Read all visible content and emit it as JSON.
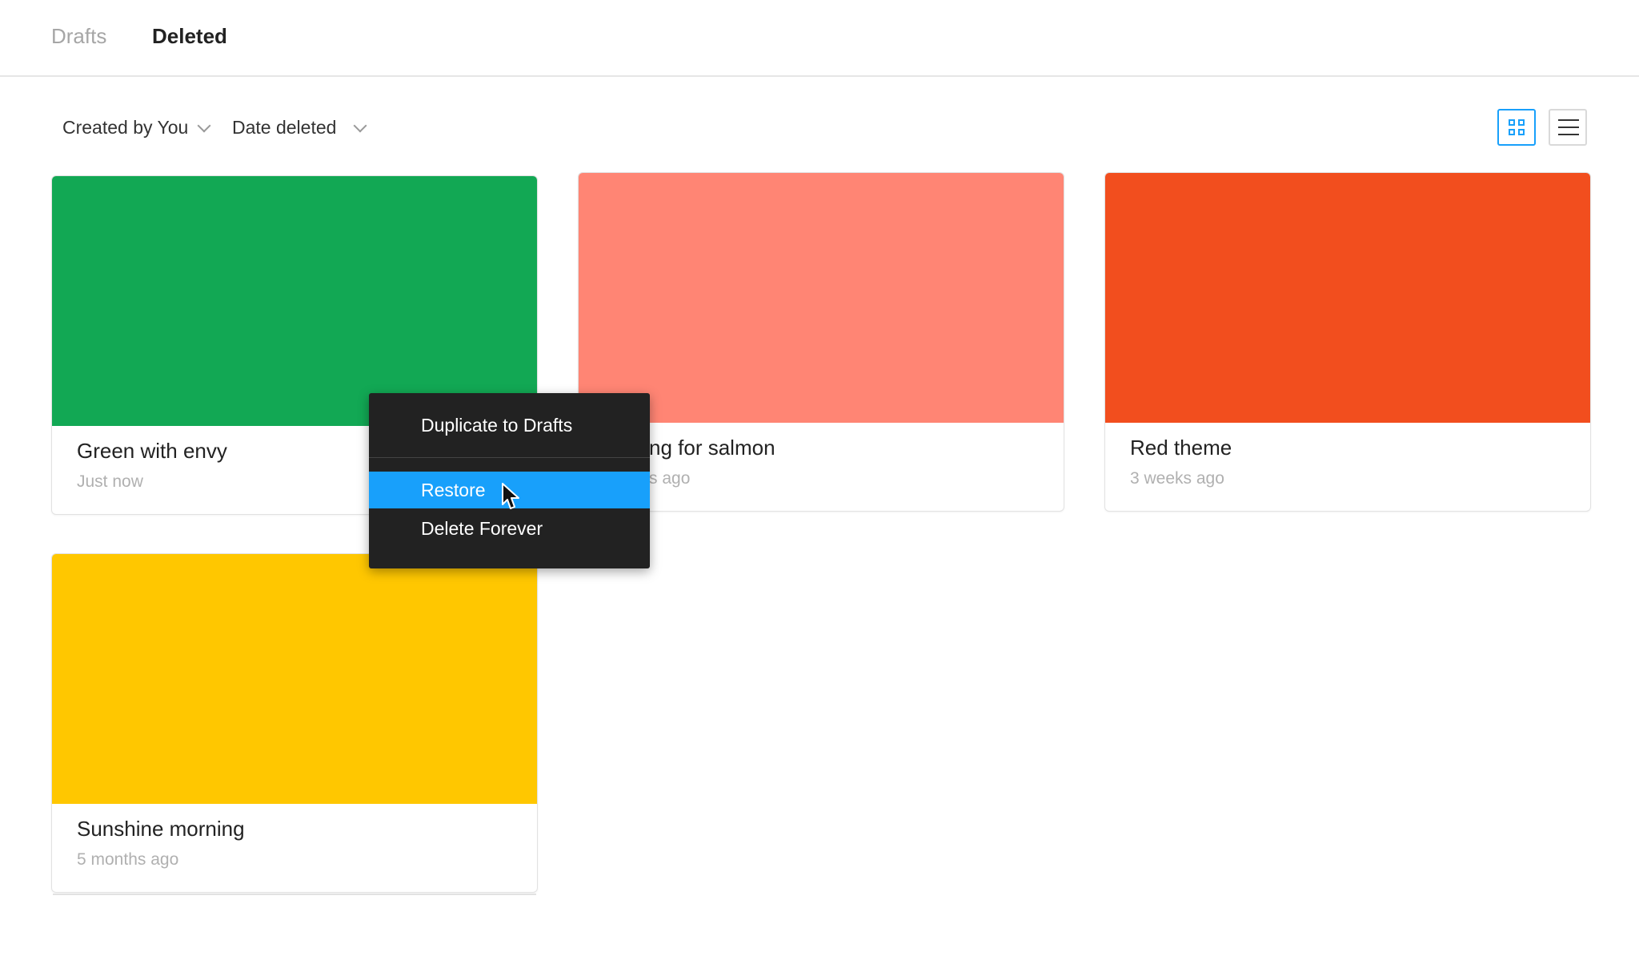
{
  "tabs": {
    "drafts": "Drafts",
    "deleted": "Deleted"
  },
  "filters": {
    "created_by": "Created by You",
    "sort": "Date deleted"
  },
  "view_toggle": {
    "active": "grid"
  },
  "files": [
    {
      "name": "Green with envy",
      "time": "Just  now",
      "color": "#12a854"
    },
    {
      "name": "ng for salmon",
      "time": "s ago",
      "color": "#ff8574"
    },
    {
      "name": "Red theme",
      "time": "3 weeks ago",
      "color": "#f24e1e"
    },
    {
      "name": "Sunshine morning",
      "time": "5 months ago",
      "color": "#ffc700"
    }
  ],
  "context_menu": {
    "duplicate": "Duplicate to Drafts",
    "restore": "Restore",
    "delete_forever": "Delete Forever",
    "highlight_color": "#18a0fb"
  }
}
